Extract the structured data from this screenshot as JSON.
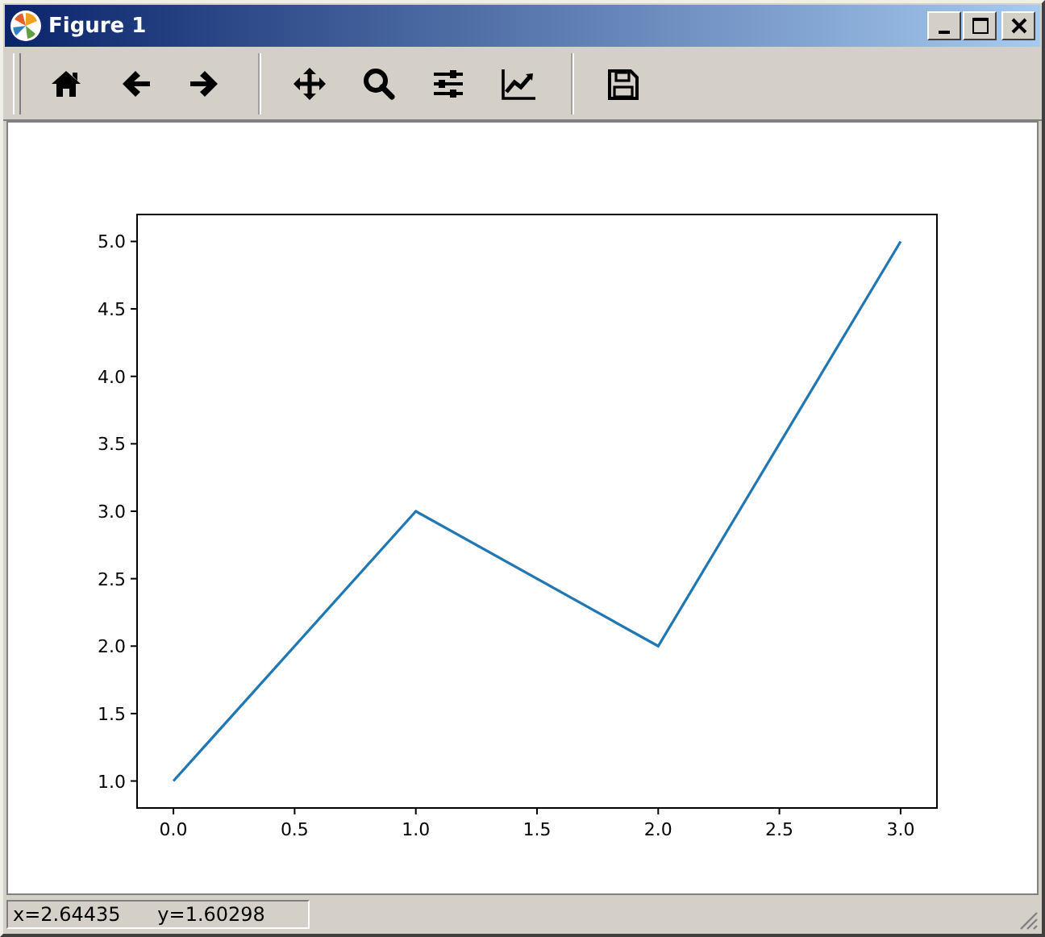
{
  "window": {
    "title": "Figure 1"
  },
  "toolbar": {
    "items": [
      {
        "kind": "home"
      },
      {
        "kind": "back"
      },
      {
        "kind": "forward"
      },
      {
        "kind": "separator"
      },
      {
        "kind": "pan"
      },
      {
        "kind": "zoom"
      },
      {
        "kind": "subplots"
      },
      {
        "kind": "lines"
      },
      {
        "kind": "separator"
      },
      {
        "kind": "save"
      }
    ]
  },
  "figure": {
    "chart_data": {
      "type": "line",
      "x": [
        0,
        1,
        2,
        3
      ],
      "series": [
        {
          "color": "#1f77b4",
          "values": [
            1,
            3,
            2,
            5
          ]
        }
      ],
      "xlim": [
        -0.15,
        3.15
      ],
      "ylim": [
        0.8,
        5.2
      ],
      "xticks": [
        {
          "value": 0,
          "label": "0.0"
        },
        {
          "value": 0.5,
          "label": "0.5"
        },
        {
          "value": 1,
          "label": "1.0"
        },
        {
          "value": 1.5,
          "label": "1.5"
        },
        {
          "value": 2,
          "label": "2.0"
        },
        {
          "value": 2.5,
          "label": "2.5"
        },
        {
          "value": 3,
          "label": "3.0"
        }
      ],
      "yticks": [
        {
          "value": 1,
          "label": "1.0"
        },
        {
          "value": 1.5,
          "label": "1.5"
        },
        {
          "value": 2,
          "label": "2.0"
        },
        {
          "value": 2.5,
          "label": "2.5"
        },
        {
          "value": 3,
          "label": "3.0"
        },
        {
          "value": 3.5,
          "label": "3.5"
        },
        {
          "value": 4,
          "label": "4.0"
        },
        {
          "value": 4.5,
          "label": "4.5"
        },
        {
          "value": 5,
          "label": "5.0"
        }
      ]
    }
  },
  "status_bar": {
    "text": "x=2.64435      y=1.60298"
  }
}
